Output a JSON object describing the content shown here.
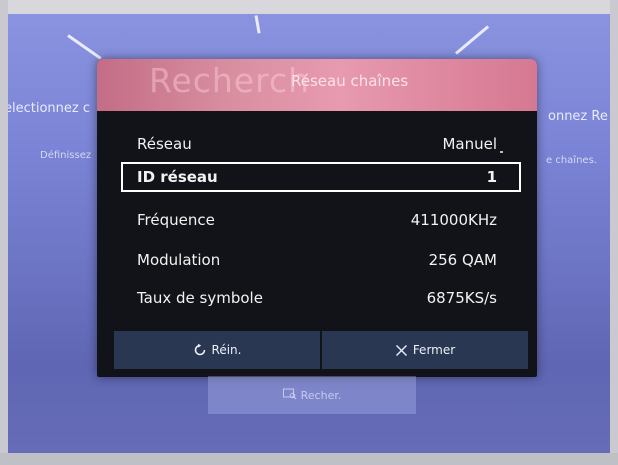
{
  "background": {
    "left_heading": "electionnez c",
    "left_sub": "Définissez",
    "right_heading": "onnez Re",
    "right_sub": "e chaînes.",
    "bottom_button_label": "Recher."
  },
  "dialog": {
    "ghost_title": "Recherch",
    "title": "Réseau chaînes",
    "rows": [
      {
        "label": "Réseau",
        "value": "Manuel"
      },
      {
        "label": "ID réseau",
        "value": "1"
      },
      {
        "label": "Fréquence",
        "value": "411000KHz"
      },
      {
        "label": "Modulation",
        "value": "256 QAM"
      },
      {
        "label": "Taux de symbole",
        "value": "6875KS/s"
      }
    ],
    "selected_row": "ID réseau",
    "buttons": {
      "reset_label": "Réin.",
      "close_label": "Fermer"
    }
  },
  "icons": {
    "reset": "refresh-icon",
    "close": "close-icon",
    "search": "search-icon"
  },
  "colors": {
    "screen_bg": "#7b84d6",
    "dialog_bg": "#111318",
    "header_accent": "#d98ea0",
    "button_bg": "#2a3753"
  }
}
